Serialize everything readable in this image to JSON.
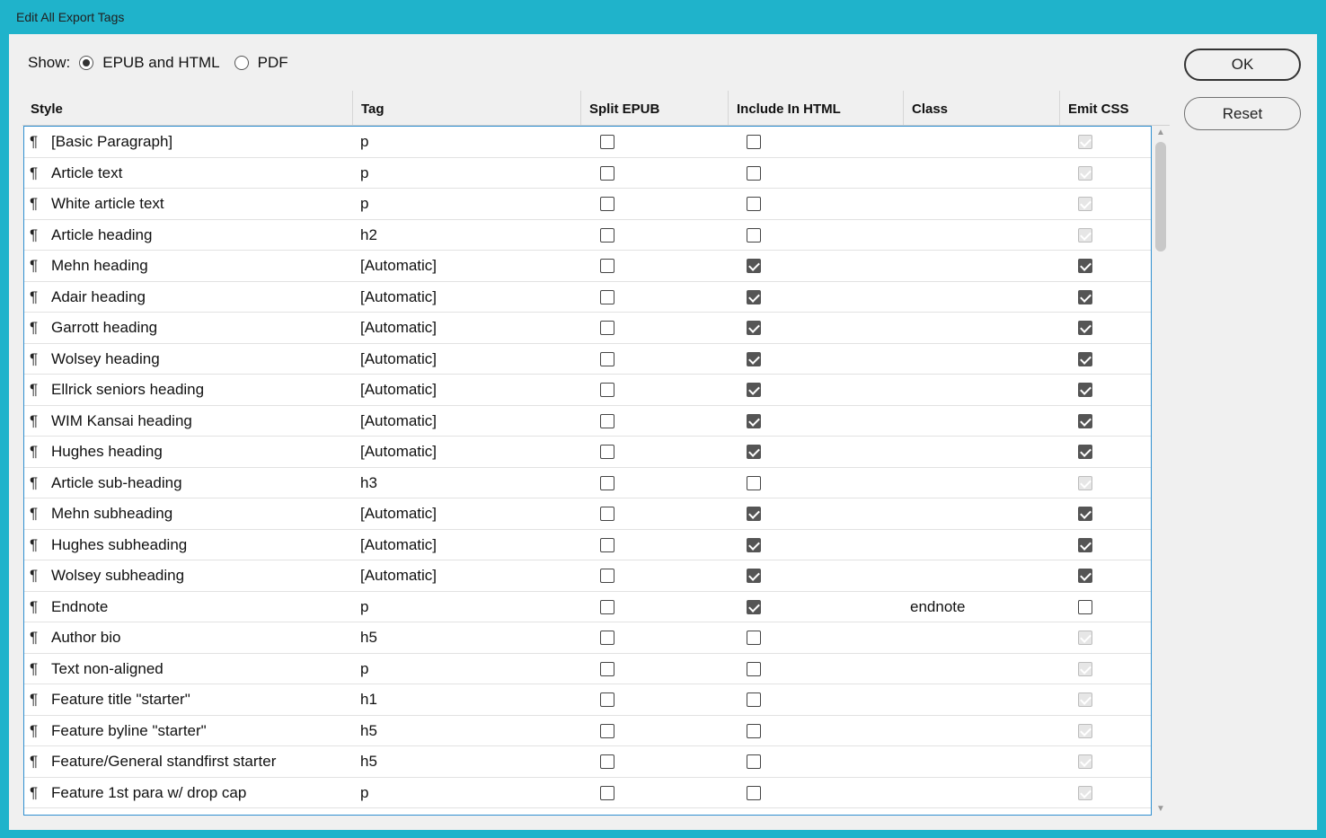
{
  "window": {
    "title": "Edit All Export Tags"
  },
  "show": {
    "label": "Show:",
    "options": [
      {
        "label": "EPUB and HTML",
        "selected": true
      },
      {
        "label": "PDF",
        "selected": false
      }
    ]
  },
  "buttons": {
    "ok": "OK",
    "reset": "Reset"
  },
  "columns": [
    "Style",
    "Tag",
    "Split EPUB",
    "Include In HTML",
    "Class",
    "Emit CSS"
  ],
  "rows": [
    {
      "style": "[Basic Paragraph]",
      "tag": "p",
      "split": false,
      "include": false,
      "class": "",
      "emit": "disabled"
    },
    {
      "style": "Article text",
      "tag": "p",
      "split": false,
      "include": false,
      "class": "",
      "emit": "disabled"
    },
    {
      "style": "White article text",
      "tag": "p",
      "split": false,
      "include": false,
      "class": "",
      "emit": "disabled"
    },
    {
      "style": "Article heading",
      "tag": "h2",
      "split": false,
      "include": false,
      "class": "",
      "emit": "disabled"
    },
    {
      "style": "Mehn heading",
      "tag": "[Automatic]",
      "split": false,
      "include": true,
      "class": "",
      "emit": "checked"
    },
    {
      "style": "Adair heading",
      "tag": "[Automatic]",
      "split": false,
      "include": true,
      "class": "",
      "emit": "checked"
    },
    {
      "style": "Garrott heading",
      "tag": "[Automatic]",
      "split": false,
      "include": true,
      "class": "",
      "emit": "checked"
    },
    {
      "style": "Wolsey heading",
      "tag": "[Automatic]",
      "split": false,
      "include": true,
      "class": "",
      "emit": "checked"
    },
    {
      "style": "Ellrick seniors heading",
      "tag": "[Automatic]",
      "split": false,
      "include": true,
      "class": "",
      "emit": "checked"
    },
    {
      "style": "WIM Kansai heading",
      "tag": "[Automatic]",
      "split": false,
      "include": true,
      "class": "",
      "emit": "checked"
    },
    {
      "style": "Hughes heading",
      "tag": "[Automatic]",
      "split": false,
      "include": true,
      "class": "",
      "emit": "checked"
    },
    {
      "style": "Article sub-heading",
      "tag": "h3",
      "split": false,
      "include": false,
      "class": "",
      "emit": "disabled"
    },
    {
      "style": "Mehn subheading",
      "tag": "[Automatic]",
      "split": false,
      "include": true,
      "class": "",
      "emit": "checked"
    },
    {
      "style": "Hughes subheading",
      "tag": "[Automatic]",
      "split": false,
      "include": true,
      "class": "",
      "emit": "checked"
    },
    {
      "style": "Wolsey subheading",
      "tag": "[Automatic]",
      "split": false,
      "include": true,
      "class": "",
      "emit": "checked"
    },
    {
      "style": "Endnote",
      "tag": "p",
      "split": false,
      "include": true,
      "class": "endnote",
      "emit": "unchecked"
    },
    {
      "style": "Author bio",
      "tag": "h5",
      "split": false,
      "include": false,
      "class": "",
      "emit": "disabled"
    },
    {
      "style": "Text non-aligned",
      "tag": "p",
      "split": false,
      "include": false,
      "class": "",
      "emit": "disabled"
    },
    {
      "style": "Feature title \"starter\"",
      "tag": "h1",
      "split": false,
      "include": false,
      "class": "",
      "emit": "disabled"
    },
    {
      "style": "Feature byline \"starter\"",
      "tag": "h5",
      "split": false,
      "include": false,
      "class": "",
      "emit": "disabled"
    },
    {
      "style": "Feature/General standfirst starter",
      "tag": "h5",
      "split": false,
      "include": false,
      "class": "",
      "emit": "disabled"
    },
    {
      "style": "Feature 1st para w/ drop cap",
      "tag": "p",
      "split": false,
      "include": false,
      "class": "",
      "emit": "disabled"
    }
  ]
}
